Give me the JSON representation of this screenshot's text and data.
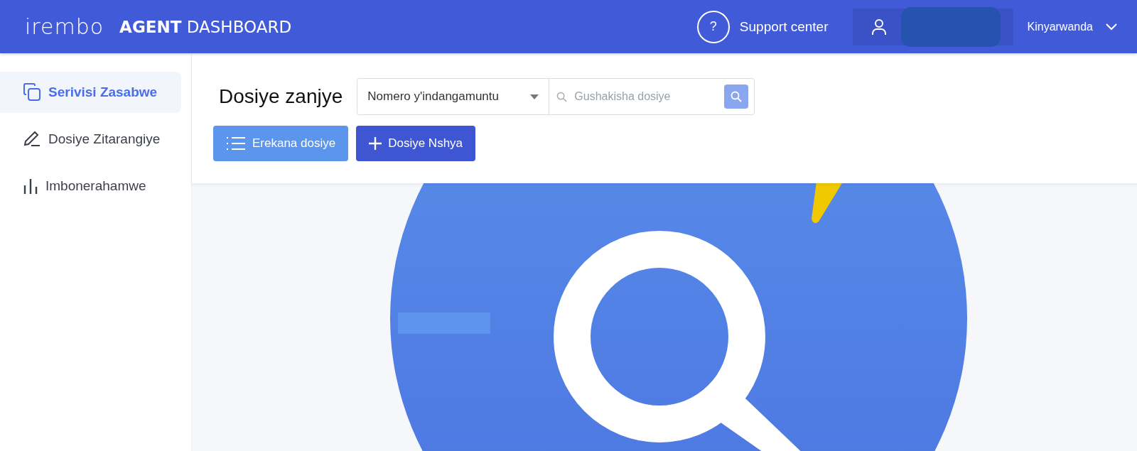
{
  "header": {
    "logo": "irembo",
    "title": "**AGENT** DASHBOARD",
    "help_glyph": "?",
    "support_link": "Support center",
    "language": "Kinyarwanda"
  },
  "sidebar": {
    "items": [
      {
        "label": "Serivisi Zasabwe",
        "selected": true
      },
      {
        "label": "Dosiye Zitarangiye",
        "selected": false
      },
      {
        "label": "Imbonerahamwe",
        "selected": false
      }
    ]
  },
  "toolbar": {
    "title": "Dosiye zanjye",
    "search_type": "Nomero y'indangamuntu",
    "search": {
      "placeholder": "Gushakisha dosiye"
    },
    "buttons": [
      {
        "label": "Erekana dosiye",
        "kind": "secondary"
      },
      {
        "label": "Dosiye Nshya",
        "kind": "primary"
      }
    ]
  }
}
